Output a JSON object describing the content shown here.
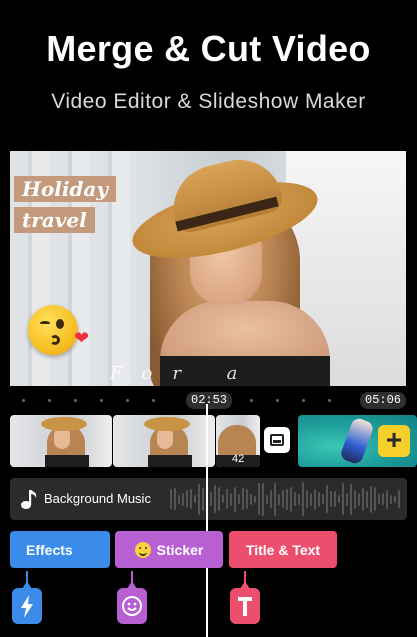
{
  "headline": "Merge & Cut Video",
  "subheadline": "Video Editor & Slideshow Maker",
  "preview": {
    "text_labels": [
      "Holiday",
      "travel"
    ],
    "watermark": "For a Moment",
    "sticker_icons": [
      "kiss-emoji-icon",
      "heart-icon"
    ]
  },
  "timeline": {
    "current_time": "02:53",
    "total_time": "05:06",
    "clip_number": "42",
    "add_clip_icon": "plus-icon",
    "transition_icon": "transition-icon"
  },
  "music": {
    "label": "Background Music",
    "icon": "music-note-icon"
  },
  "tools": [
    {
      "label": "Effects",
      "icon": "lightning-icon",
      "color": "#3b8be8"
    },
    {
      "label": "Sticker",
      "icon": "smiley-icon",
      "color": "#b75fd3"
    },
    {
      "label": "Title & Text",
      "icon": "text-t-icon",
      "color": "#ec4f6d"
    }
  ],
  "colors": {
    "background": "#000000",
    "add_button": "#f7cf2a",
    "label_box": "#c49a7c"
  }
}
